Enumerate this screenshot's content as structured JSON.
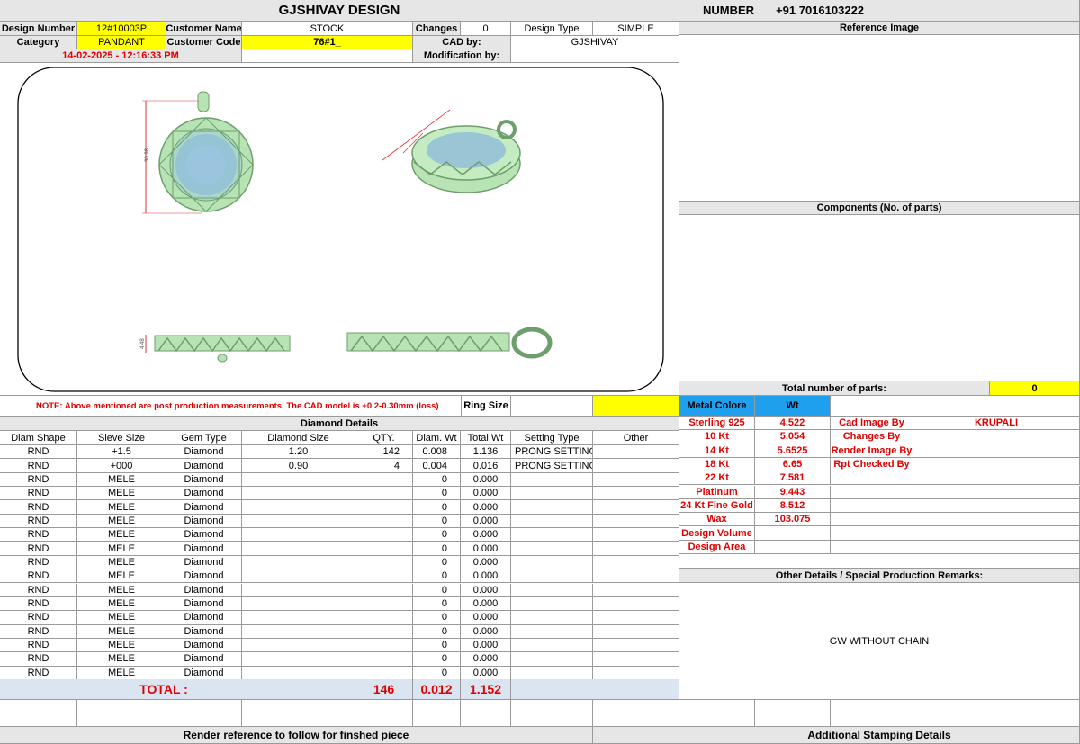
{
  "header": {
    "title": "GJSHIVAY DESIGN",
    "number_label": "NUMBER",
    "number_value": "+91 7016103222"
  },
  "info": {
    "design_number_label": "Design Number",
    "design_number": "12#10003P",
    "customer_name_label": "Customer Name",
    "customer_name": "STOCK",
    "changes_label": "Changes",
    "changes": "0",
    "design_type_label": "Design Type",
    "design_type": "SIMPLE",
    "category_label": "Category",
    "category": "PANDANT",
    "customer_code_label": "Customer Code",
    "customer_code": "76#1_",
    "cad_by_label": "CAD by:",
    "cad_by": "GJSHIVAY",
    "datetime": "14-02-2025 - 12:16:33 PM",
    "modification_label": "Modification by:"
  },
  "drawing": {
    "dim_height": "30.98",
    "dim_side": "4.48"
  },
  "note": {
    "text": "NOTE: Above mentioned are post production measurements. The CAD model is +0.2-0.30mm (loss)",
    "ring_size_label": "Ring Size"
  },
  "right": {
    "reference_image": "Reference Image",
    "components": "Components (No. of parts)",
    "total_parts_label": "Total number of parts:",
    "total_parts": "0",
    "other_details": "Other Details / Special Production Remarks:",
    "remarks": "GW WITHOUT CHAIN",
    "stamping": "Additional Stamping Details"
  },
  "metal": {
    "header_label": "Metal Colore",
    "header_wt": "Wt",
    "rows": [
      {
        "label": "Sterling 925",
        "wt": "4.522",
        "k": "Cad Image By",
        "v": "KRUPALI"
      },
      {
        "label": "10 Kt",
        "wt": "5.054",
        "k": "Changes By",
        "v": ""
      },
      {
        "label": "14 Kt",
        "wt": "5.6525",
        "k": "Render Image By",
        "v": ""
      },
      {
        "label": "18 Kt",
        "wt": "6.65",
        "k": "Rpt Checked By",
        "v": ""
      },
      {
        "label": "22 Kt",
        "wt": "7.581",
        "k": "",
        "v": ""
      },
      {
        "label": "Platinum",
        "wt": "9.443",
        "k": "",
        "v": ""
      },
      {
        "label": "24 Kt Fine Gold",
        "wt": "8.512",
        "k": "",
        "v": ""
      },
      {
        "label": "Wax",
        "wt": "103.075",
        "k": "",
        "v": ""
      },
      {
        "label": "Design Volume",
        "wt": "",
        "k": "",
        "v": ""
      },
      {
        "label": "Design Area",
        "wt": "",
        "k": "",
        "v": ""
      }
    ]
  },
  "diamond": {
    "title": "Diamond Details",
    "columns": [
      "Diam Shape",
      "Sieve Size",
      "Gem Type",
      "Diamond Size",
      "QTY.",
      "Diam. Wt",
      "Total Wt",
      "Setting Type",
      "Other"
    ],
    "rows": [
      [
        "RND",
        "+1.5",
        "Diamond",
        "1.20",
        "142",
        "0.008",
        "1.136",
        "PRONG SETTING",
        ""
      ],
      [
        "RND",
        "+000",
        "Diamond",
        "0.90",
        "4",
        "0.004",
        "0.016",
        "PRONG SETTING",
        ""
      ],
      [
        "RND",
        "MELE",
        "Diamond",
        "",
        "",
        "0",
        "0.000",
        "",
        ""
      ],
      [
        "RND",
        "MELE",
        "Diamond",
        "",
        "",
        "0",
        "0.000",
        "",
        ""
      ],
      [
        "RND",
        "MELE",
        "Diamond",
        "",
        "",
        "0",
        "0.000",
        "",
        ""
      ],
      [
        "RND",
        "MELE",
        "Diamond",
        "",
        "",
        "0",
        "0.000",
        "",
        ""
      ],
      [
        "RND",
        "MELE",
        "Diamond",
        "",
        "",
        "0",
        "0.000",
        "",
        ""
      ],
      [
        "RND",
        "MELE",
        "Diamond",
        "",
        "",
        "0",
        "0.000",
        "",
        ""
      ],
      [
        "RND",
        "MELE",
        "Diamond",
        "",
        "",
        "0",
        "0.000",
        "",
        ""
      ],
      [
        "RND",
        "MELE",
        "Diamond",
        "",
        "",
        "0",
        "0.000",
        "",
        ""
      ],
      [
        "RND",
        "MELE",
        "Diamond",
        "",
        "",
        "0",
        "0.000",
        "",
        ""
      ],
      [
        "RND",
        "MELE",
        "Diamond",
        "",
        "",
        "0",
        "0.000",
        "",
        ""
      ],
      [
        "RND",
        "MELE",
        "Diamond",
        "",
        "",
        "0",
        "0.000",
        "",
        ""
      ],
      [
        "RND",
        "MELE",
        "Diamond",
        "",
        "",
        "0",
        "0.000",
        "",
        ""
      ],
      [
        "RND",
        "MELE",
        "Diamond",
        "",
        "",
        "0",
        "0.000",
        "",
        ""
      ],
      [
        "RND",
        "MELE",
        "Diamond",
        "",
        "",
        "0",
        "0.000",
        "",
        ""
      ],
      [
        "RND",
        "MELE",
        "Diamond",
        "",
        "",
        "0",
        "0.000",
        "",
        ""
      ]
    ],
    "total_label": "TOTAL :",
    "total_qty": "146",
    "total_diam_wt": "0.012",
    "total_wt": "1.152"
  },
  "footer": {
    "render_ref": "Render reference to follow for finshed piece"
  },
  "colors": {
    "header_grey": "#e7e6e6",
    "highlight_yellow": "#ffff00",
    "metal_blue": "#1fa0ef",
    "total_blue": "#dbe5f1",
    "red_text": "#e00000",
    "model_green": "#b7e3b5"
  }
}
